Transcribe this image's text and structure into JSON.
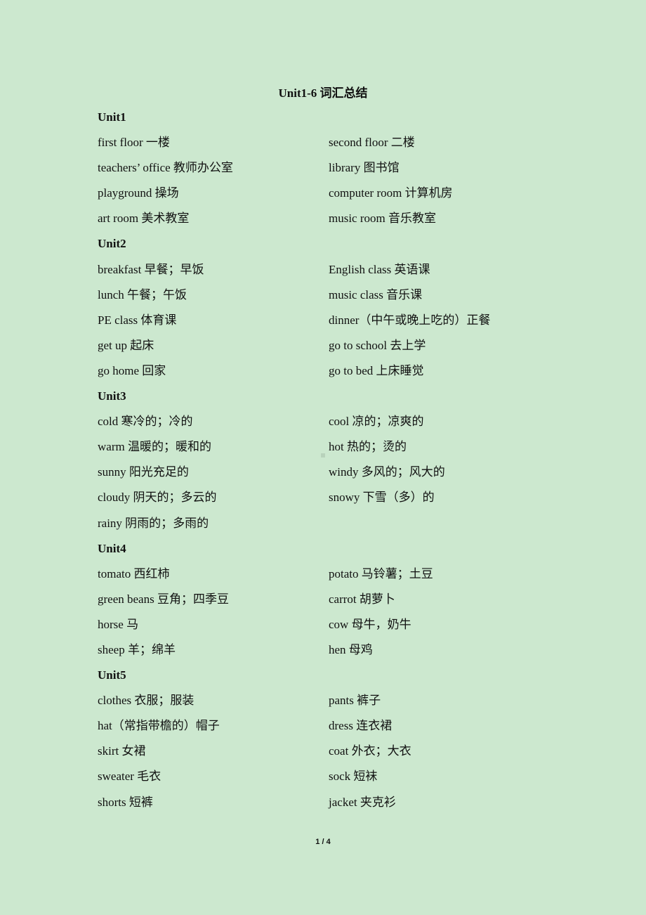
{
  "title": "Unit1-6  词汇总结",
  "units": [
    {
      "name": "Unit1",
      "rows": [
        [
          "first floor 一楼",
          "second floor 二楼"
        ],
        [
          "teachers’ office 教师办公室",
          "library 图书馆"
        ],
        [
          "playground 操场",
          "computer room 计算机房"
        ],
        [
          "art room 美术教室",
          "music room 音乐教室"
        ]
      ]
    },
    {
      "name": "Unit2",
      "rows": [
        [
          "breakfast 早餐；早饭",
          "English class 英语课"
        ],
        [
          "lunch 午餐；午饭",
          "music class 音乐课"
        ],
        [
          "PE class 体育课",
          "dinner（中午或晚上吃的）正餐"
        ],
        [
          "get up 起床",
          "go to school 去上学"
        ],
        [
          "go home 回家",
          "go to bed 上床睡觉"
        ]
      ]
    },
    {
      "name": "Unit3",
      "rows": [
        [
          "cold 寒冷的；冷的",
          "cool 凉的；凉爽的"
        ],
        [
          "warm 温暖的；暖和的",
          "hot 热的；烫的"
        ],
        [
          "sunny 阳光充足的",
          "windy 多风的；风大的"
        ],
        [
          "cloudy 阴天的；多云的",
          "snowy 下雪（多）的"
        ],
        [
          "rainy 阴雨的；多雨的",
          ""
        ]
      ]
    },
    {
      "name": "Unit4",
      "rows": [
        [
          "tomato 西红柿",
          "potato 马铃薯；土豆"
        ],
        [
          "green beans 豆角；四季豆",
          "carrot 胡萝卜"
        ],
        [
          "horse 马",
          "cow 母牛，奶牛"
        ],
        [
          "sheep 羊；绵羊",
          "hen 母鸡"
        ]
      ]
    },
    {
      "name": "Unit5",
      "rows": [
        [
          "clothes 衣服；服装",
          "pants 裤子"
        ],
        [
          "hat（常指带檐的）帽子",
          "dress 连衣裙"
        ],
        [
          "skirt 女裙",
          "coat 外衣；大衣"
        ],
        [
          "sweater 毛衣",
          "sock 短袜"
        ],
        [
          "shorts 短裤",
          "jacket 夹克衫"
        ]
      ]
    }
  ],
  "footer": {
    "page": "1 / 4"
  }
}
